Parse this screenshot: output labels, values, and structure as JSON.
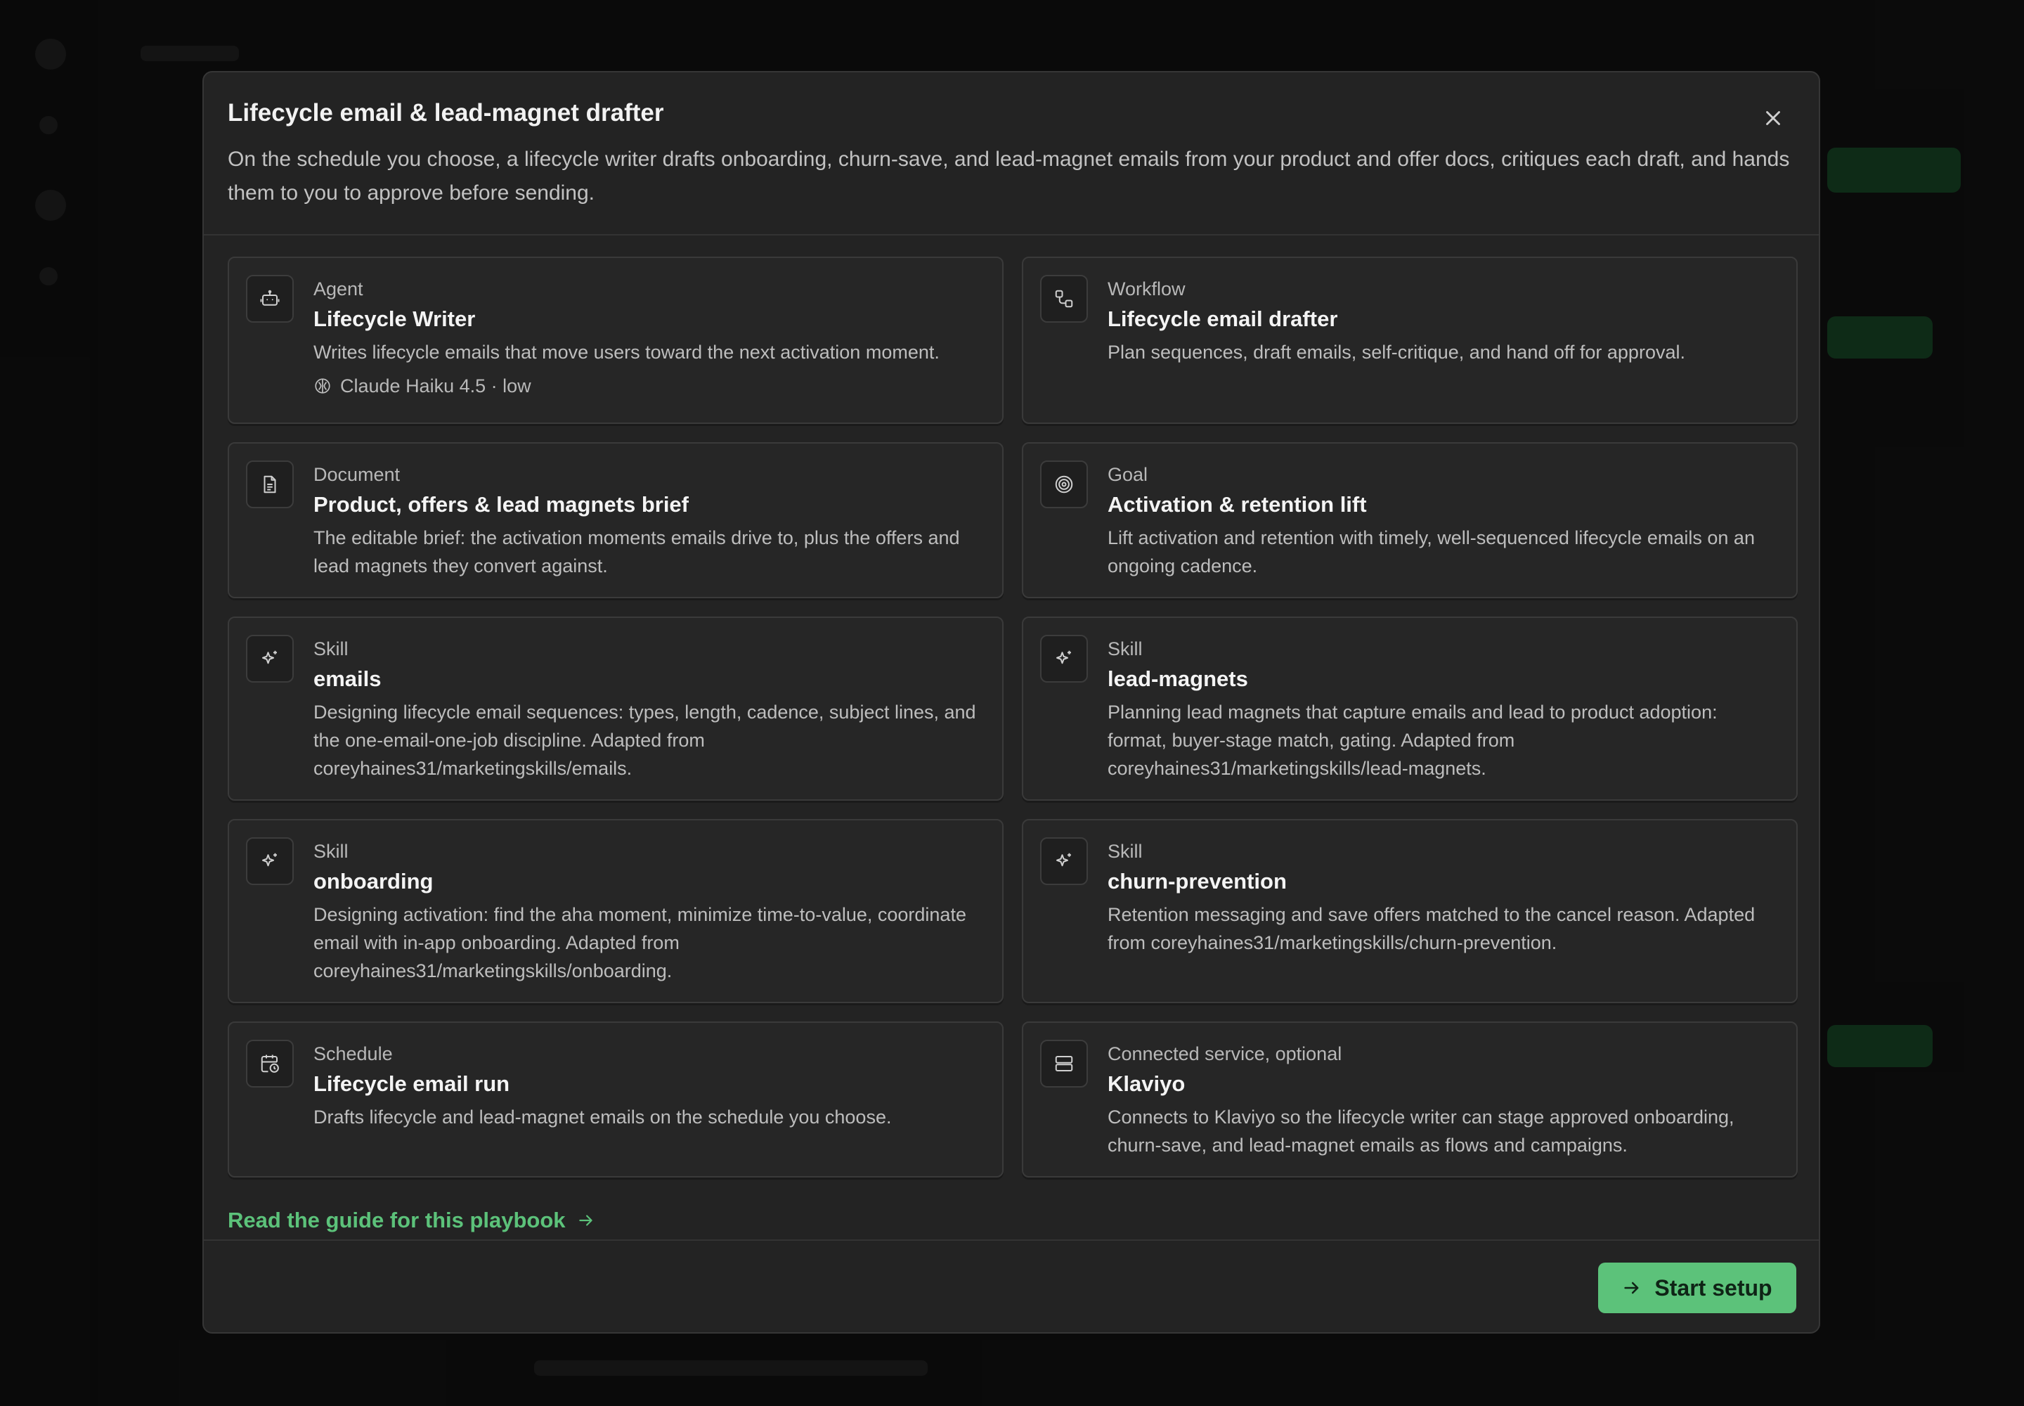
{
  "modal": {
    "title": "Lifecycle email & lead-magnet drafter",
    "description": "On the schedule you choose, a lifecycle writer drafts onboarding, churn-save, and lead-magnet emails from your product and offer docs, critiques each draft, and hands them to you to approve before sending.",
    "close_icon": "close-icon"
  },
  "cards": [
    {
      "type": "Agent",
      "title": "Lifecycle Writer",
      "description": "Writes lifecycle emails that move users toward the next activation moment.",
      "meta": "Claude Haiku 4.5 · low",
      "icon": "robot-icon"
    },
    {
      "type": "Workflow",
      "title": "Lifecycle email drafter",
      "description": "Plan sequences, draft emails, self-critique, and hand off for approval.",
      "icon": "workflow-icon"
    },
    {
      "type": "Document",
      "title": "Product, offers & lead magnets brief",
      "description": "The editable brief: the activation moments emails drive to, plus the offers and lead magnets they convert against.",
      "icon": "document-icon"
    },
    {
      "type": "Goal",
      "title": "Activation & retention lift",
      "description": "Lift activation and retention with timely, well-sequenced lifecycle emails on an ongoing cadence.",
      "icon": "target-icon"
    },
    {
      "type": "Skill",
      "title": "emails",
      "description": "Designing lifecycle email sequences: types, length, cadence, subject lines, and the one-email-one-job discipline. Adapted from coreyhaines31/marketingskills/emails.",
      "icon": "sparkle-icon"
    },
    {
      "type": "Skill",
      "title": "lead-magnets",
      "description": "Planning lead magnets that capture emails and lead to product adoption: format, buyer-stage match, gating. Adapted from coreyhaines31/marketingskills/lead-magnets.",
      "icon": "sparkle-icon"
    },
    {
      "type": "Skill",
      "title": "onboarding",
      "description": "Designing activation: find the aha moment, minimize time-to-value, coordinate email with in-app onboarding. Adapted from coreyhaines31/marketingskills/onboarding.",
      "icon": "sparkle-icon"
    },
    {
      "type": "Skill",
      "title": "churn-prevention",
      "description": "Retention messaging and save offers matched to the cancel reason. Adapted from coreyhaines31/marketingskills/churn-prevention.",
      "icon": "sparkle-icon"
    },
    {
      "type": "Schedule",
      "title": "Lifecycle email run",
      "description": "Drafts lifecycle and lead-magnet emails on the schedule you choose.",
      "icon": "calendar-clock-icon"
    },
    {
      "type": "Connected service, optional",
      "title": "Klaviyo",
      "description": "Connects to Klaviyo so the lifecycle writer can stage approved onboarding, churn-save, and lead-magnet emails as flows and campaigns.",
      "icon": "server-icon"
    }
  ],
  "footer": {
    "guide_link": "Read the guide for this playbook",
    "start_button": "Start setup"
  },
  "colors": {
    "accent": "#5cc27a",
    "modal_bg": "#232323",
    "card_bg": "#262626"
  }
}
